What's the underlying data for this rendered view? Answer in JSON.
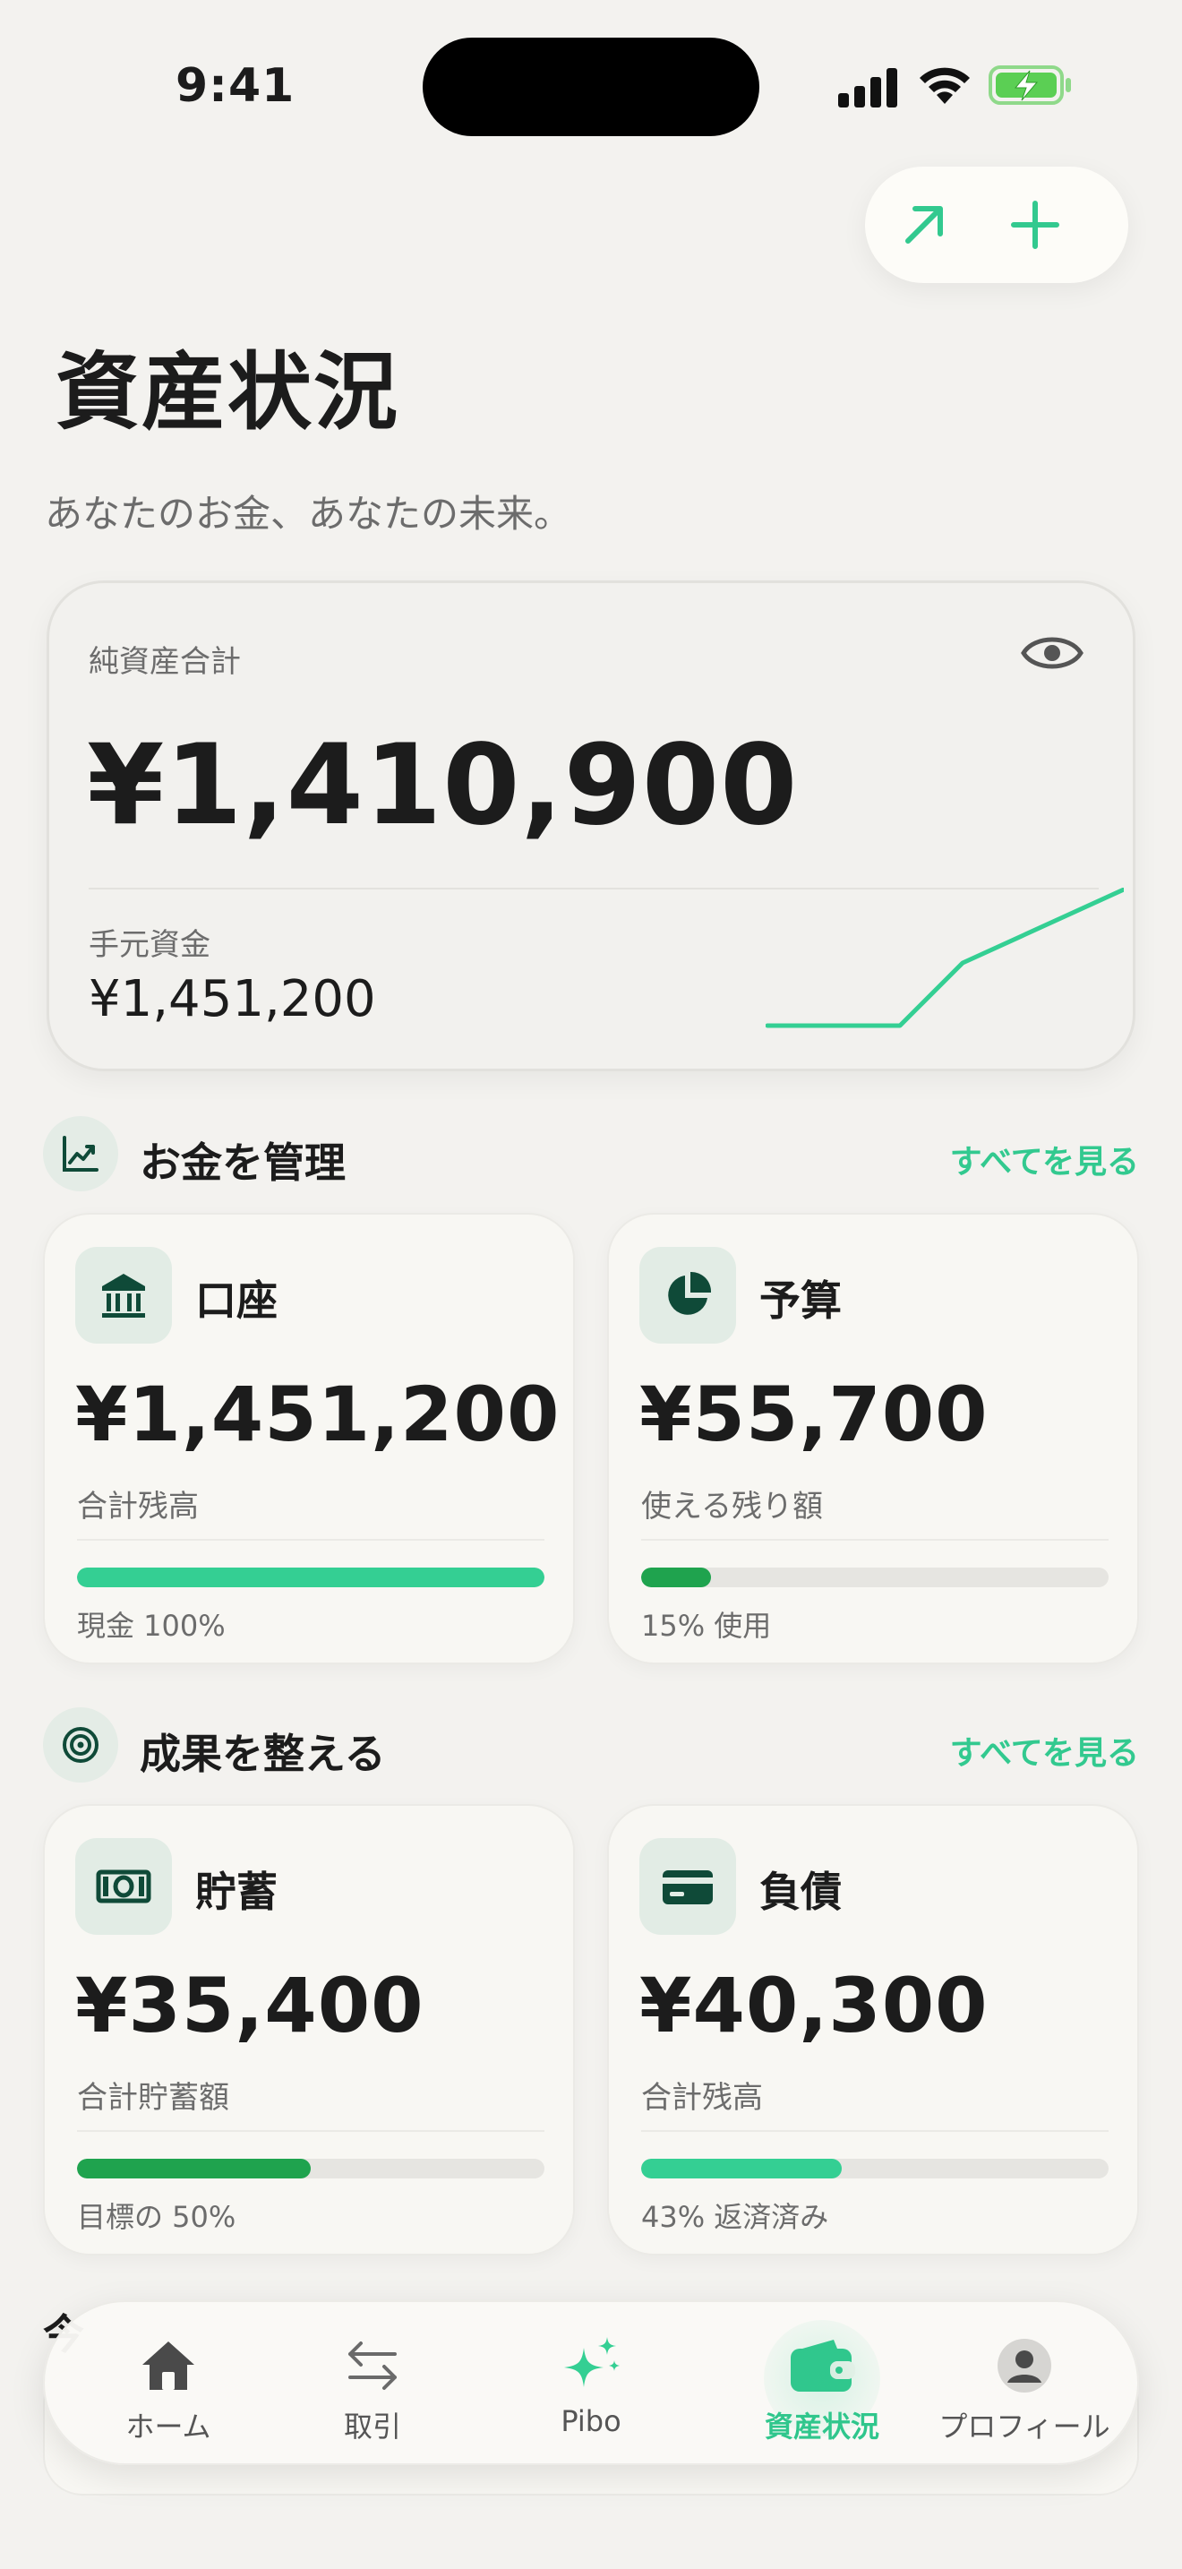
{
  "status": {
    "time": "9:41"
  },
  "header": {
    "title": "資産状況",
    "subtitle": "あなたのお金、あなたの未来。"
  },
  "net_worth": {
    "label": "純資産合計",
    "amount": "¥1,410,900",
    "cash_label": "手元資金",
    "cash_amount": "¥1,451,200"
  },
  "section_manage": {
    "title": "お金を管理",
    "see_all": "すべてを見る"
  },
  "section_goals": {
    "title": "成果を整える",
    "see_all": "すべてを見る"
  },
  "tiles": [
    {
      "title": "口座",
      "amount": "¥1,451,200",
      "sub": "合計残高",
      "caption": "現金 100%",
      "progress": 1.0,
      "color": "#34cf93",
      "icon": "bank-icon"
    },
    {
      "title": "予算",
      "amount": "¥55,700",
      "sub": "使える残り額",
      "caption": "15% 使用",
      "progress": 0.15,
      "color": "#1fa34e",
      "icon": "pie-chart-icon"
    },
    {
      "title": "貯蓄",
      "amount": "¥35,400",
      "sub": "合計貯蓄額",
      "caption": "目標の 50%",
      "progress": 0.5,
      "color": "#1fa34e",
      "icon": "banknote-icon"
    },
    {
      "title": "負債",
      "amount": "¥40,300",
      "sub": "合計残高",
      "caption": "43% 返済済み",
      "progress": 0.43,
      "color": "#34cf93",
      "icon": "credit-card-icon"
    }
  ],
  "hidden_section": {
    "title": "今"
  },
  "tabs": [
    {
      "label": "ホーム",
      "icon": "home-icon",
      "active": false
    },
    {
      "label": "取引",
      "icon": "arrows-icon",
      "active": false
    },
    {
      "label": "Pibo",
      "icon": "sparkle-icon",
      "active": false
    },
    {
      "label": "資産状況",
      "icon": "wallet-icon",
      "active": true
    },
    {
      "label": "プロフィール",
      "icon": "profile-icon",
      "active": false
    }
  ],
  "colors": {
    "accent": "#32c98f",
    "dark_green": "#0f4a38",
    "bar_green": "#1fa34e"
  }
}
